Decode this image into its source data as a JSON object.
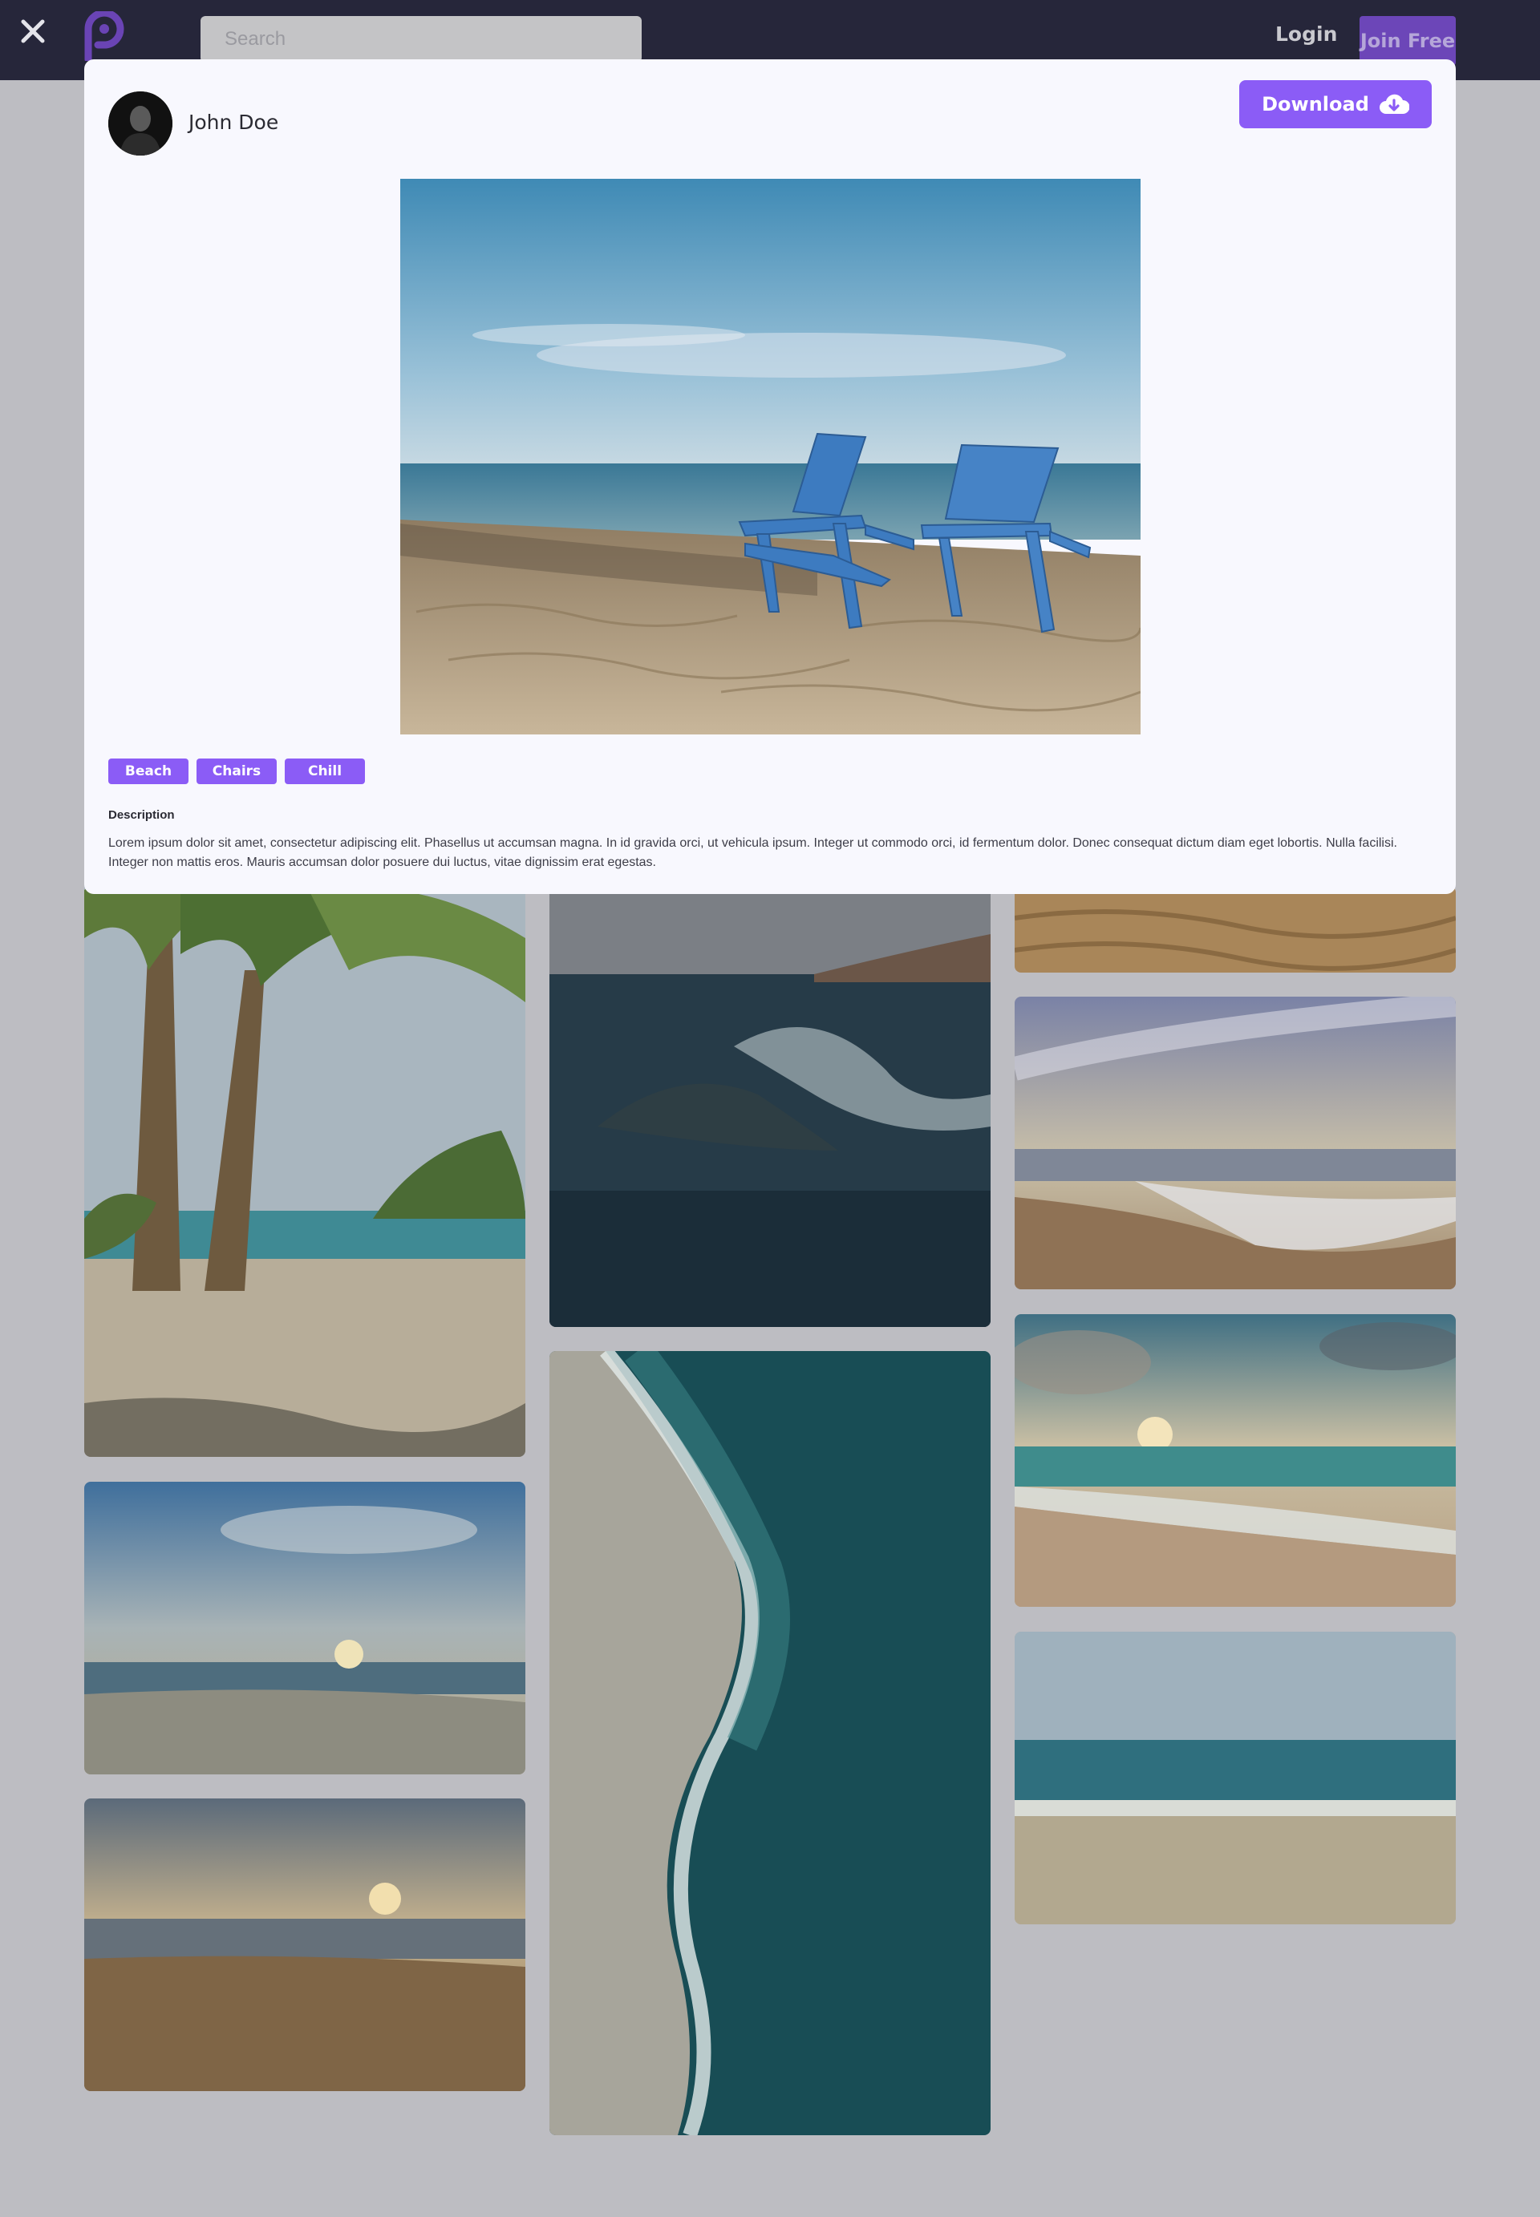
{
  "header": {
    "close_icon": "close-icon",
    "logo_icon": "logo-icon",
    "search_placeholder": "Search",
    "login_label": "Login",
    "join_label": "Join Free"
  },
  "modal": {
    "author_name": "John Doe",
    "download_label": "Download",
    "download_icon": "cloud-download-icon",
    "tags": [
      "Beach",
      "Chairs",
      "Chill"
    ],
    "description_label": "Description",
    "description_text": "Lorem ipsum dolor sit amet, consectetur adipiscing elit. Phasellus ut accumsan magna. In id gravida orci, ut vehicula ipsum. Integer ut commodo orci, id fermentum dolor. Donec consequat dictum diam eget lobortis. Nulla facilisi. Integer non mattis eros. Mauris accumsan dolor posuere dui luctus, vitae dignissim erat egestas."
  },
  "colors": {
    "accent": "#8b5cf6",
    "header_bg": "#26263a",
    "overlay_bg": "#bdbdc2",
    "modal_bg": "#f8f8fe"
  }
}
